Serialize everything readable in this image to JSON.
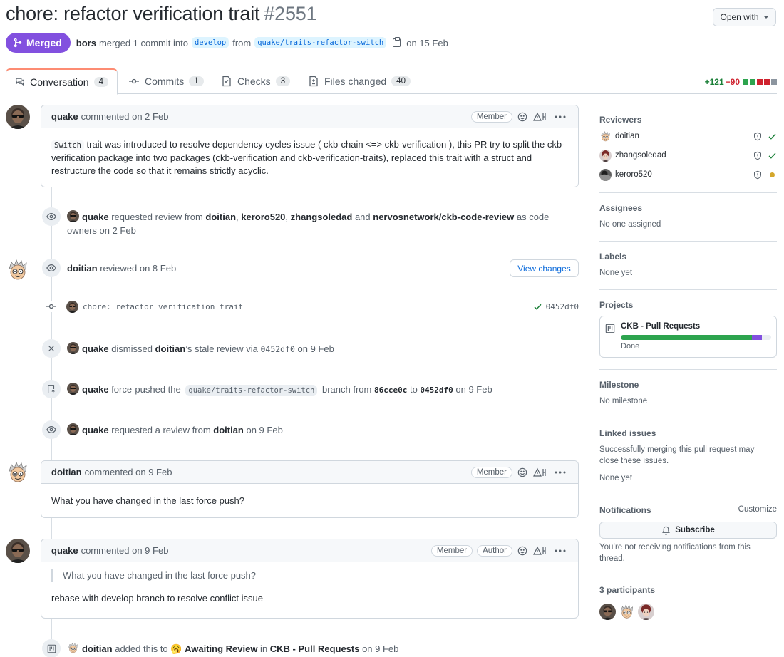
{
  "header": {
    "title": "chore: refactor verification trait",
    "number": "#2551",
    "open_with": "Open with",
    "status": "Merged",
    "merge_user": "bors",
    "merge_text": "merged 1 commit into",
    "base_branch": "develop",
    "from_text": "from",
    "head_branch": "quake/traits-refactor-switch",
    "date_text": "on 15 Feb"
  },
  "tabs": [
    {
      "label": "Conversation",
      "count": "4"
    },
    {
      "label": "Commits",
      "count": "1"
    },
    {
      "label": "Checks",
      "count": "3"
    },
    {
      "label": "Files changed",
      "count": "40"
    }
  ],
  "diffstat": {
    "additions": "+121",
    "deletions": "−90"
  },
  "timeline": {
    "c1": {
      "author": "quake",
      "action": "commented on 2 Feb",
      "role": "Member",
      "code": "Switch",
      "text": " trait was introduced to resolve dependency cycles issue ( ckb-chain <=> ckb-verification ), this PR try to split the ckb-verification package into two packages (ckb-verification and ckb-verification-traits), replaced this trait with a struct and restructure the code so that it remains strictly acyclic."
    },
    "e1": {
      "user": "quake",
      "t1": " requested review from ",
      "r1": "doitian",
      "r2": "keroro520",
      "r3": "zhangsoledad",
      "and": " and ",
      "r4": "nervosnetwork/ckb-code-review",
      "t2": " as code owners on 2 Feb"
    },
    "e2": {
      "user": "doitian",
      "text": " reviewed on 8 Feb",
      "button": "View changes"
    },
    "commit": {
      "message": "chore: refactor verification trait",
      "sha": "0452df0"
    },
    "e3": {
      "user": "quake",
      "t1": " dismissed ",
      "target": "doitian",
      "t2": "’s stale review via ",
      "sha": "0452df0",
      "t3": " on 9 Feb"
    },
    "e4": {
      "user": "quake",
      "t1": " force-pushed the ",
      "branch": "quake/traits-refactor-switch",
      "t2": " branch from ",
      "from": "86cce0c",
      "to_text": " to ",
      "to": "0452df0",
      "t3": " on 9 Feb"
    },
    "e5": {
      "user": "quake",
      "t1": " requested a review from ",
      "target": "doitian",
      "t2": " on 9 Feb"
    },
    "c2": {
      "author": "doitian",
      "action": "commented on 9 Feb",
      "role": "Member",
      "text": "What you have changed in the last force push?"
    },
    "c3": {
      "author": "quake",
      "action": "commented on 9 Feb",
      "role1": "Member",
      "role2": "Author",
      "quote": "What you have changed in the last force push?",
      "text": "rebase with develop branch to resolve conflict issue"
    },
    "e6": {
      "user": "doitian",
      "t1": " added this to ",
      "emoji": "🥱",
      "column": "Awaiting Review",
      "t2": " in ",
      "project": "CKB - Pull Requests",
      "t3": " on 9 Feb"
    }
  },
  "sidebar": {
    "reviewers": {
      "title": "Reviewers",
      "items": [
        {
          "name": "doitian",
          "state": "approved"
        },
        {
          "name": "zhangsoledad",
          "state": "approved"
        },
        {
          "name": "keroro520",
          "state": "pending"
        }
      ]
    },
    "assignees": {
      "title": "Assignees",
      "value": "No one assigned"
    },
    "labels": {
      "title": "Labels",
      "value": "None yet"
    },
    "projects": {
      "title": "Projects",
      "name": "CKB - Pull Requests",
      "status": "Done",
      "progress_done": 0.87,
      "progress_in_progress": 0.07
    },
    "milestone": {
      "title": "Milestone",
      "value": "No milestone"
    },
    "linked": {
      "title": "Linked issues",
      "desc": "Successfully merging this pull request may close these issues.",
      "value": "None yet"
    },
    "notifications": {
      "title": "Notifications",
      "customize": "Customize",
      "button": "Subscribe",
      "desc": "You’re not receiving notifications from this thread."
    },
    "participants": {
      "title": "3 participants"
    }
  },
  "colors": {
    "merged": "#8250df",
    "link": "#0969da",
    "add": "#1a7f37",
    "del": "#cf222e",
    "pending": "#d4a72c"
  }
}
